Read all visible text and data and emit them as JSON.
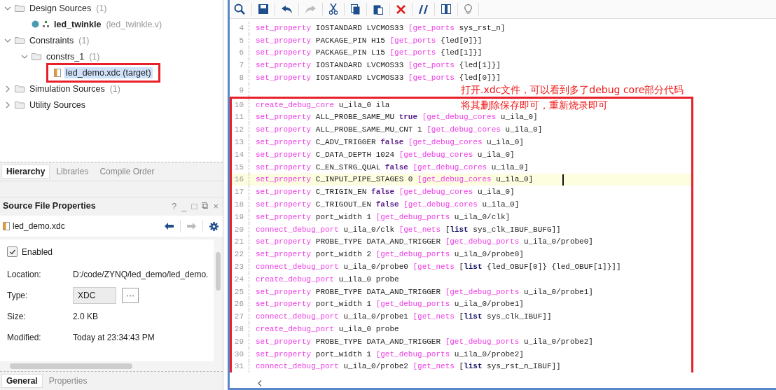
{
  "sources_tree": {
    "items": [
      {
        "label": "Design Sources",
        "count": "(1)",
        "expanded": true,
        "kind": "folder",
        "selected": false,
        "children": [
          {
            "label": "led_twinkle",
            "file": "(led_twinkle.v)",
            "kind": "module",
            "selected": false
          }
        ]
      },
      {
        "label": "Constraints",
        "count": "(1)",
        "expanded": true,
        "kind": "folder",
        "selected": false,
        "children": [
          {
            "label": "constrs_1",
            "count": "(1)",
            "expanded": true,
            "kind": "folder",
            "selected": false,
            "children": [
              {
                "label": "led_demo.xdc (target)",
                "kind": "xdc",
                "selected": true,
                "annotated": true
              }
            ]
          }
        ]
      },
      {
        "label": "Simulation Sources",
        "count": "(1)",
        "expanded": false,
        "kind": "folder",
        "selected": false
      },
      {
        "label": "Utility Sources",
        "expanded": false,
        "kind": "folder",
        "selected": false
      }
    ]
  },
  "sources_tabs": [
    {
      "label": "Hierarchy",
      "selected": true
    },
    {
      "label": "Libraries",
      "selected": false
    },
    {
      "label": "Compile Order",
      "selected": false
    }
  ],
  "properties": {
    "title": "Source File Properties",
    "window_buttons": [
      "?",
      "_",
      "□",
      "⧉",
      "×"
    ],
    "file": "led_demo.xdc",
    "enabled": {
      "label": "Enabled",
      "checked": true
    },
    "rows": [
      {
        "label": "Location:",
        "value": "D:/code/ZYNQ/led_demo/led_demo.",
        "kind": "text"
      },
      {
        "label": "Type:",
        "value": "XDC",
        "kind": "field",
        "button": "···"
      },
      {
        "label": "Size:",
        "value": "2.0 KB",
        "kind": "text"
      },
      {
        "label": "Modified:",
        "value": "Today at 23:34:43 PM",
        "kind": "text"
      }
    ],
    "tabs": [
      {
        "label": "General",
        "selected": true
      },
      {
        "label": "Properties",
        "selected": false
      }
    ]
  },
  "editor": {
    "annotation": {
      "lines": [
        "打开.xdc文件，可以看到多了debug core部分代码",
        "将其删除保存即可，重新烧录即可"
      ]
    },
    "lines": [
      {
        "number": "4",
        "current": false,
        "segments": [
          {
            "kind": "command",
            "text": "set_property"
          },
          {
            "kind": "plain",
            "text": " IOSTANDARD LVCMOS33 "
          },
          {
            "kind": "command",
            "text": "[get_ports"
          },
          {
            "kind": "plain",
            "text": " sys_rst_n]"
          }
        ]
      },
      {
        "number": "5",
        "current": false,
        "segments": [
          {
            "kind": "command",
            "text": "set_property"
          },
          {
            "kind": "plain",
            "text": " PACKAGE_PIN H15 "
          },
          {
            "kind": "command",
            "text": "[get_ports"
          },
          {
            "kind": "plain",
            "text": " {led[0]}]"
          }
        ]
      },
      {
        "number": "6",
        "current": false,
        "segments": [
          {
            "kind": "command",
            "text": "set_property"
          },
          {
            "kind": "plain",
            "text": " PACKAGE_PIN L15 "
          },
          {
            "kind": "command",
            "text": "[get_ports"
          },
          {
            "kind": "plain",
            "text": " {led[1]}]"
          }
        ]
      },
      {
        "number": "7",
        "current": false,
        "segments": [
          {
            "kind": "command",
            "text": "set_property"
          },
          {
            "kind": "plain",
            "text": " IOSTANDARD LVCMOS33 "
          },
          {
            "kind": "command",
            "text": "[get_ports"
          },
          {
            "kind": "plain",
            "text": " {led[1]}]"
          }
        ]
      },
      {
        "number": "8",
        "current": false,
        "segments": [
          {
            "kind": "command",
            "text": "set_property"
          },
          {
            "kind": "plain",
            "text": " IOSTANDARD LVCMOS33 "
          },
          {
            "kind": "command",
            "text": "[get_ports"
          },
          {
            "kind": "plain",
            "text": " {led[0]}]"
          }
        ]
      },
      {
        "number": "9",
        "current": false
      }
    ],
    "boxed_lines": [
      {
        "number": "10",
        "current": false,
        "segments": [
          {
            "kind": "command",
            "text": "create_debug_core"
          },
          {
            "kind": "plain",
            "text": " u_ila_0 ila"
          }
        ]
      },
      {
        "number": "11",
        "current": false,
        "segments": [
          {
            "kind": "command",
            "text": "set_property"
          },
          {
            "kind": "plain",
            "text": " ALL_PROBE_SAME_MU "
          },
          {
            "kind": "keyword",
            "text": "true"
          },
          {
            "kind": "command",
            "text": " [get_debug_cores"
          },
          {
            "kind": "plain",
            "text": " u_ila_0]"
          }
        ]
      },
      {
        "number": "12",
        "current": false,
        "segments": [
          {
            "kind": "command",
            "text": "set_property"
          },
          {
            "kind": "plain",
            "text": " ALL_PROBE_SAME_MU_CNT 1 "
          },
          {
            "kind": "command",
            "text": "[get_debug_cores"
          },
          {
            "kind": "plain",
            "text": " u_ila_0]"
          }
        ]
      },
      {
        "number": "13",
        "current": false,
        "segments": [
          {
            "kind": "command",
            "text": "set_property"
          },
          {
            "kind": "plain",
            "text": " C_ADV_TRIGGER "
          },
          {
            "kind": "keyword",
            "text": "false"
          },
          {
            "kind": "command",
            "text": " [get_debug_cores"
          },
          {
            "kind": "plain",
            "text": " u_ila_0]"
          }
        ]
      },
      {
        "number": "14",
        "current": false,
        "segments": [
          {
            "kind": "command",
            "text": "set_property"
          },
          {
            "kind": "plain",
            "text": " C_DATA_DEPTH 1024 "
          },
          {
            "kind": "command",
            "text": "[get_debug_cores"
          },
          {
            "kind": "plain",
            "text": " u_ila_0]"
          }
        ]
      },
      {
        "number": "15",
        "current": false,
        "segments": [
          {
            "kind": "command",
            "text": "set_property"
          },
          {
            "kind": "plain",
            "text": " C_EN_STRG_QUAL "
          },
          {
            "kind": "keyword",
            "text": "false"
          },
          {
            "kind": "command",
            "text": " [get_debug_cores"
          },
          {
            "kind": "plain",
            "text": " u_ila_0]"
          }
        ]
      },
      {
        "number": "16",
        "current": true,
        "segments": [
          {
            "kind": "command",
            "text": "set_property"
          },
          {
            "kind": "plain",
            "text": " C_INPUT_PIPE_STAGES 0 "
          },
          {
            "kind": "command",
            "text": "[get_debug_cores"
          },
          {
            "kind": "plain",
            "text": " u_ila_0]"
          }
        ]
      },
      {
        "number": "17",
        "current": false,
        "segments": [
          {
            "kind": "command",
            "text": "set_property"
          },
          {
            "kind": "plain",
            "text": " C_TRIGIN_EN "
          },
          {
            "kind": "keyword",
            "text": "false"
          },
          {
            "kind": "command",
            "text": " [get_debug_cores"
          },
          {
            "kind": "plain",
            "text": " u_ila_0]"
          }
        ]
      },
      {
        "number": "18",
        "current": false,
        "segments": [
          {
            "kind": "command",
            "text": "set_property"
          },
          {
            "kind": "plain",
            "text": " C_TRIGOUT_EN "
          },
          {
            "kind": "keyword",
            "text": "false"
          },
          {
            "kind": "command",
            "text": " [get_debug_cores"
          },
          {
            "kind": "plain",
            "text": " u_ila_0]"
          }
        ]
      },
      {
        "number": "19",
        "current": false,
        "segments": [
          {
            "kind": "command",
            "text": "set_property"
          },
          {
            "kind": "plain",
            "text": " port_width 1 "
          },
          {
            "kind": "command",
            "text": "[get_debug_ports"
          },
          {
            "kind": "plain",
            "text": " u_ila_0/clk]"
          }
        ]
      },
      {
        "number": "20",
        "current": false,
        "segments": [
          {
            "kind": "command",
            "text": "connect_debug_port"
          },
          {
            "kind": "plain",
            "text": " u_ila_0/clk "
          },
          {
            "kind": "command",
            "text": "[get_nets"
          },
          {
            "kind": "plain",
            "text": " ["
          },
          {
            "kind": "list",
            "text": "list"
          },
          {
            "kind": "plain",
            "text": " sys_clk_IBUF_BUFG]]"
          }
        ]
      },
      {
        "number": "21",
        "current": false,
        "segments": [
          {
            "kind": "command",
            "text": "set_property"
          },
          {
            "kind": "plain",
            "text": " PROBE_TYPE DATA_AND_TRIGGER "
          },
          {
            "kind": "command",
            "text": "[get_debug_ports"
          },
          {
            "kind": "plain",
            "text": " u_ila_0/probe0]"
          }
        ]
      },
      {
        "number": "22",
        "current": false,
        "segments": [
          {
            "kind": "command",
            "text": "set_property"
          },
          {
            "kind": "plain",
            "text": " port_width 2 "
          },
          {
            "kind": "command",
            "text": "[get_debug_ports"
          },
          {
            "kind": "plain",
            "text": " u_ila_0/probe0]"
          }
        ]
      },
      {
        "number": "23",
        "current": false,
        "segments": [
          {
            "kind": "command",
            "text": "connect_debug_port"
          },
          {
            "kind": "plain",
            "text": " u_ila_0/probe0 "
          },
          {
            "kind": "command",
            "text": "[get_nets"
          },
          {
            "kind": "plain",
            "text": " ["
          },
          {
            "kind": "list",
            "text": "list"
          },
          {
            "kind": "plain",
            "text": " {led_OBUF[0]} {led_OBUF[1]}]]"
          }
        ]
      },
      {
        "number": "24",
        "current": false,
        "segments": [
          {
            "kind": "command",
            "text": "create_debug_port"
          },
          {
            "kind": "plain",
            "text": " u_ila_0 probe"
          }
        ]
      },
      {
        "number": "25",
        "current": false,
        "segments": [
          {
            "kind": "command",
            "text": "set_property"
          },
          {
            "kind": "plain",
            "text": " PROBE_TYPE DATA_AND_TRIGGER "
          },
          {
            "kind": "command",
            "text": "[get_debug_ports"
          },
          {
            "kind": "plain",
            "text": " u_ila_0/probe1]"
          }
        ]
      },
      {
        "number": "26",
        "current": false,
        "segments": [
          {
            "kind": "command",
            "text": "set_property"
          },
          {
            "kind": "plain",
            "text": " port_width 1 "
          },
          {
            "kind": "command",
            "text": "[get_debug_ports"
          },
          {
            "kind": "plain",
            "text": " u_ila_0/probe1]"
          }
        ]
      },
      {
        "number": "27",
        "current": false,
        "segments": [
          {
            "kind": "command",
            "text": "connect_debug_port"
          },
          {
            "kind": "plain",
            "text": " u_ila_0/probe1 "
          },
          {
            "kind": "command",
            "text": "[get_nets"
          },
          {
            "kind": "plain",
            "text": " ["
          },
          {
            "kind": "list",
            "text": "list"
          },
          {
            "kind": "plain",
            "text": " sys_clk_IBUF]]"
          }
        ]
      },
      {
        "number": "28",
        "current": false,
        "segments": [
          {
            "kind": "command",
            "text": "create_debug_port"
          },
          {
            "kind": "plain",
            "text": " u_ila_0 probe"
          }
        ]
      },
      {
        "number": "29",
        "current": false,
        "segments": [
          {
            "kind": "command",
            "text": "set_property"
          },
          {
            "kind": "plain",
            "text": " PROBE_TYPE DATA_AND_TRIGGER "
          },
          {
            "kind": "command",
            "text": "[get_debug_ports"
          },
          {
            "kind": "plain",
            "text": " u_ila_0/probe2]"
          }
        ]
      },
      {
        "number": "30",
        "current": false,
        "segments": [
          {
            "kind": "command",
            "text": "set_property"
          },
          {
            "kind": "plain",
            "text": " port_width 1 "
          },
          {
            "kind": "command",
            "text": "[get_debug_ports"
          },
          {
            "kind": "plain",
            "text": " u_ila_0/probe2]"
          }
        ]
      },
      {
        "number": "31",
        "current": false,
        "segments": [
          {
            "kind": "command",
            "text": "connect_debug_port"
          },
          {
            "kind": "plain",
            "text": " u_ila_0/probe2 "
          },
          {
            "kind": "command",
            "text": "[get_nets"
          },
          {
            "kind": "plain",
            "text": " ["
          },
          {
            "kind": "list",
            "text": "list"
          },
          {
            "kind": "plain",
            "text": " sys_rst_n_IBUF]]"
          }
        ]
      }
    ]
  }
}
